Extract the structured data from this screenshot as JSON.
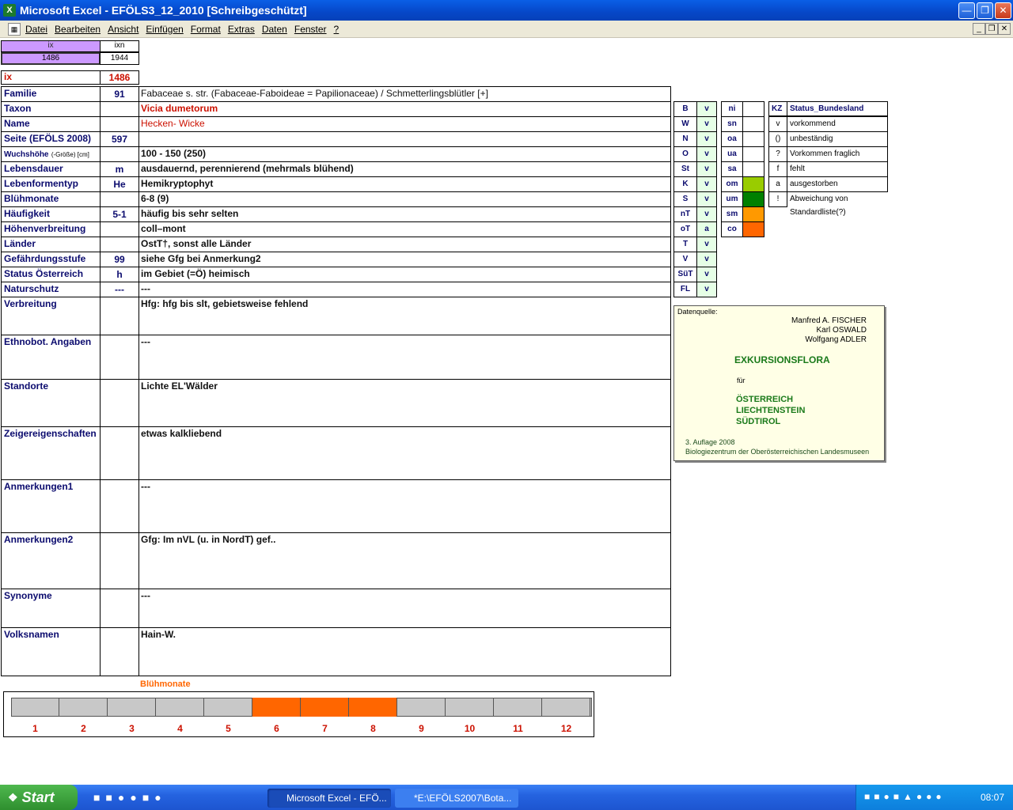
{
  "window": {
    "title": "Microsoft Excel - EFÖLS3_12_2010  [Schreibgeschützt]"
  },
  "menu": [
    "Datei",
    "Bearbeiten",
    "Ansicht",
    "Einfügen",
    "Format",
    "Extras",
    "Daten",
    "Fenster",
    "?"
  ],
  "top": {
    "ix_hdr": "ix",
    "ixn_hdr": "ixn",
    "ix_val": "1486",
    "ixn_val": "1944",
    "ix_label": "ix",
    "ix_big": "1486"
  },
  "rows": [
    {
      "label": "Familie",
      "val": "91",
      "text": "Fabaceae s. str. (Fabaceae-Faboideae = Papilionaceae)  /  Schmetterlingsblütler [+]"
    },
    {
      "label": "Taxon",
      "val": "",
      "text": "Vicia dumetorum"
    },
    {
      "label": "Name",
      "val": "",
      "text": "Hecken- Wicke"
    },
    {
      "label": "Seite (EFÖLS 2008)",
      "val": "597",
      "text": ""
    },
    {
      "label": "Wuchshöhe",
      "label2": "(-Größe) [cm]",
      "val": "",
      "text": " 100 - 150 (250)"
    },
    {
      "label": "Lebensdauer",
      "val": "m",
      "text": "ausdauernd, perennierend (mehrmals blühend)"
    },
    {
      "label": "Lebenformentyp",
      "val": "He",
      "text": "Hemikryptophyt"
    },
    {
      "label": "Blühmonate",
      "val": "",
      "text": " 6-8 (9)"
    },
    {
      "label": "Häufigkeit",
      "val": "5-1",
      "text": "häufig bis sehr selten"
    },
    {
      "label": "Höhenverbreitung",
      "val": "",
      "text": "coll–mont"
    },
    {
      "label": "Länder",
      "val": "",
      "text": " OstT†, sonst alle Länder"
    },
    {
      "label": "Gefährdungsstufe",
      "val": "99",
      "text": "siehe Gfg bei Anmerkung2"
    },
    {
      "label": "Status Österreich",
      "val": "h",
      "text": "im Gebiet (=Ö) heimisch"
    },
    {
      "label": "Naturschutz",
      "val": "---",
      "text": " ---"
    },
    {
      "label": "Verbreitung",
      "val": "",
      "text": "Hfg: hfg bis slt, gebietsweise fehlend"
    },
    {
      "label": "Ethnobot. Angaben",
      "val": "",
      "text": "---"
    },
    {
      "label": "Standorte",
      "val": "",
      "text": "Lichte EL'Wälder"
    },
    {
      "label": "Zeigereigenschaften",
      "val": "",
      "text": "etwas kalkliebend"
    },
    {
      "label": "Anmerkungen1",
      "val": "",
      "text": "---"
    },
    {
      "label": "Anmerkungen2",
      "val": "",
      "text": "Gfg: Im nVL (u. in NordT) gef.."
    },
    {
      "label": "Synonyme",
      "val": "",
      "text": "---"
    },
    {
      "label": "Volksnamen",
      "val": "",
      "text": "Hain-W."
    }
  ],
  "provinces": [
    {
      "code": "B",
      "v": "v"
    },
    {
      "code": "W",
      "v": "v"
    },
    {
      "code": "N",
      "v": "v"
    },
    {
      "code": "O",
      "v": "v"
    },
    {
      "code": "St",
      "v": "v"
    },
    {
      "code": "K",
      "v": "v"
    },
    {
      "code": "S",
      "v": "v"
    },
    {
      "code": "nT",
      "v": "v"
    },
    {
      "code": "oT",
      "v": "a"
    },
    {
      "code": "T",
      "v": "v"
    },
    {
      "code": "V",
      "v": "v"
    },
    {
      "code": "SüT",
      "v": "v"
    },
    {
      "code": "FL",
      "v": "v"
    }
  ],
  "zones": [
    {
      "code": "ni",
      "color": ""
    },
    {
      "code": "sn",
      "color": ""
    },
    {
      "code": "oa",
      "color": ""
    },
    {
      "code": "ua",
      "color": ""
    },
    {
      "code": "sa",
      "color": ""
    },
    {
      "code": "om",
      "color": "#99cc00"
    },
    {
      "code": "um",
      "color": "#008000"
    },
    {
      "code": "sm",
      "color": "#ff9900"
    },
    {
      "code": "co",
      "color": "#ff6600"
    }
  ],
  "status_legend": {
    "kz_hdr": "KZ",
    "status_hdr": "Status_Bundesland",
    "items": [
      {
        "kz": "v",
        "text": "vorkommend"
      },
      {
        "kz": "()",
        "text": "unbeständig"
      },
      {
        "kz": "?",
        "text": "Vorkommen fraglich"
      },
      {
        "kz": "f",
        "text": "fehlt"
      },
      {
        "kz": "a",
        "text": "ausgestorben"
      },
      {
        "kz": "!",
        "text": "Abweichung von Standardliste(?)"
      }
    ]
  },
  "source": {
    "label": "Datenquelle:",
    "authors": [
      "Manfred A. FISCHER",
      "Karl OSWALD",
      "Wolfgang ADLER"
    ],
    "title": "EXKURSIONSFLORA",
    "fuer": "für",
    "countries": [
      "ÖSTERREICH",
      "LIECHTENSTEIN",
      "SÜDTIROL"
    ],
    "edition": "3. Auflage 2008",
    "publisher": "Biologiezentrum der Oberösterreichischen Landesmuseen"
  },
  "bloom": {
    "title": "Blühmonate",
    "months": [
      "1",
      "2",
      "3",
      "4",
      "5",
      "6",
      "7",
      "8",
      "9",
      "10",
      "11",
      "12"
    ],
    "active": [
      6,
      7,
      8
    ],
    "active_color": "#ff6600",
    "inactive_color": "#c8c8c8"
  },
  "taskbar": {
    "start": "Start",
    "task1": "Microsoft Excel - EFÖ...",
    "task2": "*E:\\EFÖLS2007\\Bota...",
    "clock": "08:07"
  }
}
